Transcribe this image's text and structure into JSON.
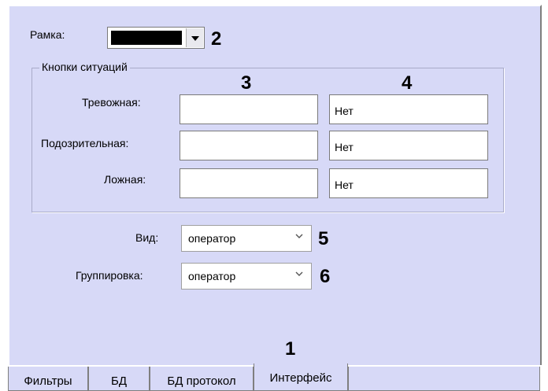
{
  "frame": {
    "label": "Рамка:",
    "color_value": "#000000"
  },
  "situation_buttons": {
    "title": "Кнопки ситуаций",
    "rows": [
      {
        "label": "Тревожная:",
        "value1": "",
        "value2": "Нет"
      },
      {
        "label": "Подозрительная:",
        "value1": "",
        "value2": "Нет"
      },
      {
        "label": "Ложная:",
        "value1": "",
        "value2": "Нет"
      }
    ]
  },
  "view": {
    "label": "Вид:",
    "value": "оператор"
  },
  "grouping": {
    "label": "Группировка:",
    "value": "оператор"
  },
  "tabs": [
    "Фильтры",
    "БД",
    "БД протокол",
    "Интерфейс"
  ],
  "callouts": {
    "tabs": "1",
    "frame": "2",
    "column1": "3",
    "column2": "4",
    "view": "5",
    "grouping": "6"
  }
}
